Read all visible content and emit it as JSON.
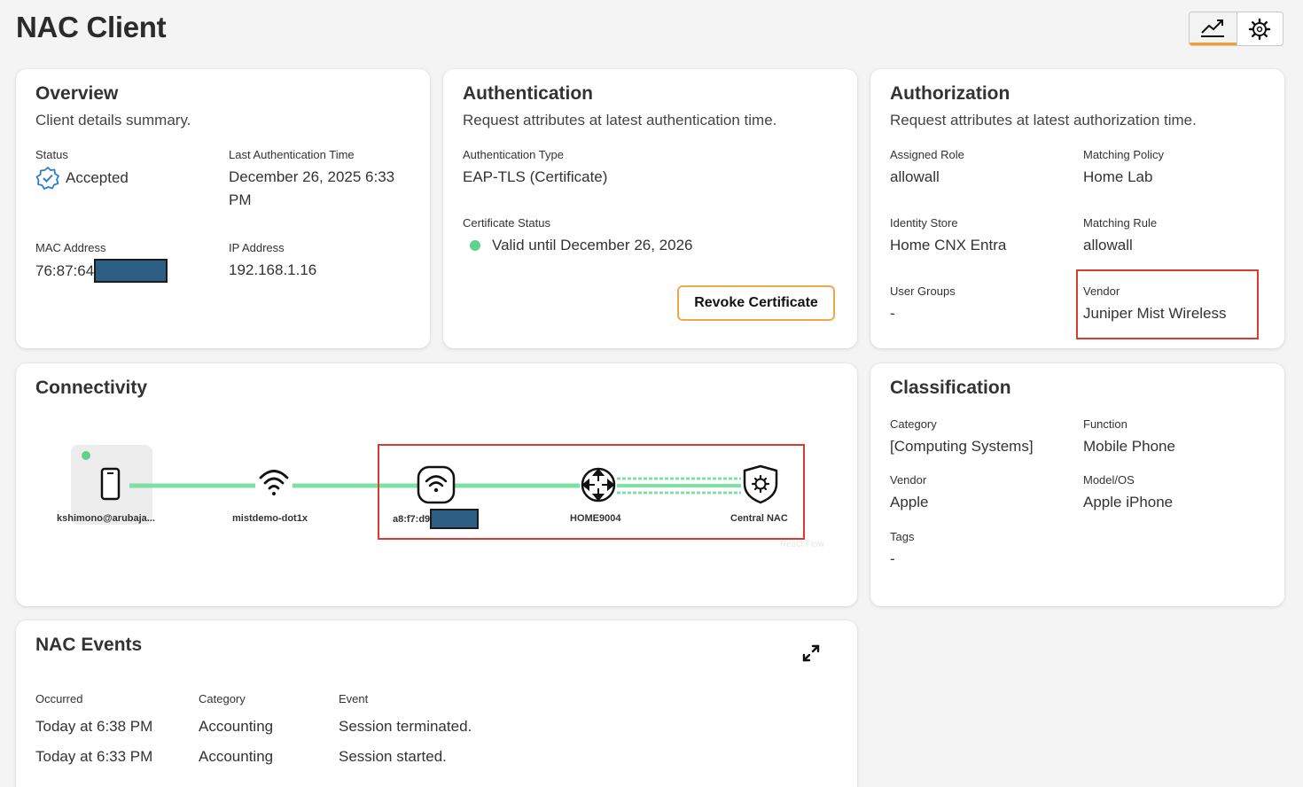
{
  "page": {
    "title": "NAC Client"
  },
  "toolbar": {
    "insights_icon": "trend-chart-icon",
    "settings_icon": "gear-icon"
  },
  "overview": {
    "title": "Overview",
    "subtitle": "Client details summary.",
    "status_label": "Status",
    "status_value": "Accepted",
    "last_auth_label": "Last Authentication Time",
    "last_auth_line1": "December 26, 2025 6:33",
    "last_auth_line2": "PM",
    "mac_label": "MAC Address",
    "mac_value": "76:87:64",
    "ip_label": "IP Address",
    "ip_value": "192.168.1.16"
  },
  "authentication": {
    "title": "Authentication",
    "subtitle": "Request attributes at latest authentication time.",
    "auth_type_label": "Authentication Type",
    "auth_type_value": "EAP-TLS (Certificate)",
    "cert_status_label": "Certificate Status",
    "cert_status_value": "Valid until December 26, 2026",
    "revoke_label": "Revoke Certificate"
  },
  "authorization": {
    "title": "Authorization",
    "subtitle": "Request attributes at latest authorization time.",
    "assigned_role_label": "Assigned Role",
    "assigned_role_value": "allowall",
    "matching_policy_label": "Matching Policy",
    "matching_policy_value": "Home Lab",
    "identity_store_label": "Identity Store",
    "identity_store_value": "Home CNX Entra",
    "matching_rule_label": "Matching Rule",
    "matching_rule_value": "allowall",
    "user_groups_label": "User Groups",
    "user_groups_value": "-",
    "vendor_label": "Vendor",
    "vendor_value": "Juniper Mist Wireless"
  },
  "connectivity": {
    "title": "Connectivity",
    "nodes": [
      {
        "label": "kshimono@arubaja...",
        "icon": "phone-icon"
      },
      {
        "label": "mistdemo-dot1x",
        "icon": "wifi-icon"
      },
      {
        "label": "a8:f7:d9",
        "icon": "access-point-icon"
      },
      {
        "label": "HOME9004",
        "icon": "router-icon"
      },
      {
        "label": "Central NAC",
        "icon": "shield-gear-icon"
      }
    ],
    "watermark": "React Flow",
    "colors": {
      "link": "#7ee0a4",
      "status_dot": "#5fd38d"
    }
  },
  "classification": {
    "title": "Classification",
    "category_label": "Category",
    "category_value": "[Computing Systems]",
    "function_label": "Function",
    "function_value": "Mobile Phone",
    "vendor_label": "Vendor",
    "vendor_value": "Apple",
    "model_label": "Model/OS",
    "model_value": "Apple iPhone",
    "tags_label": "Tags",
    "tags_value": "-"
  },
  "events": {
    "title": "NAC Events",
    "headers": {
      "occurred": "Occurred",
      "category": "Category",
      "event": "Event"
    },
    "rows": [
      {
        "occurred": "Today at 6:38 PM",
        "category": "Accounting",
        "event": "Session terminated."
      },
      {
        "occurred": "Today at 6:33 PM",
        "category": "Accounting",
        "event": "Session started."
      }
    ]
  },
  "colors": {
    "accent": "#f29e2e",
    "highlight": "#d83b2f",
    "badge_blue": "#2f7bd1",
    "redaction": "#2d5f84"
  }
}
